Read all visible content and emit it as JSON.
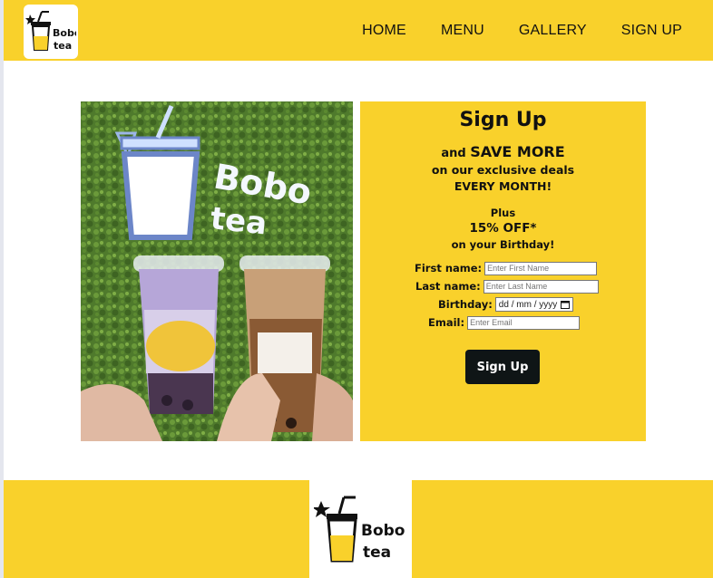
{
  "nav": {
    "items": [
      {
        "label": "HOME"
      },
      {
        "label": "MENU"
      },
      {
        "label": "GALLERY"
      },
      {
        "label": "SIGN UP"
      }
    ]
  },
  "logo": {
    "text_line1": "Bobo",
    "text_line2": "tea"
  },
  "photo": {
    "sign_line1": "Bobo",
    "sign_line2": "tea"
  },
  "signup": {
    "title": "Sign Up",
    "and": "and ",
    "save_more": "SAVE MORE",
    "line2": "on our exclusive deals",
    "line3": "EVERY MONTH!",
    "plus": "Plus",
    "discount": "15% OFF*",
    "birthday": "on your Birthday!",
    "fields": {
      "first_label": "First name:",
      "first_placeholder": "Enter First Name",
      "last_label": "Last name:",
      "last_placeholder": "Enter Last Name",
      "bday_label": "Birthday:",
      "bday_placeholder": "dd / mm / yyyy",
      "email_label": "Email:",
      "email_placeholder": "Enter Email"
    },
    "button_label": "Sign Up"
  },
  "colors": {
    "brand_yellow": "#f9d12b",
    "button_dark": "#0f1516"
  }
}
